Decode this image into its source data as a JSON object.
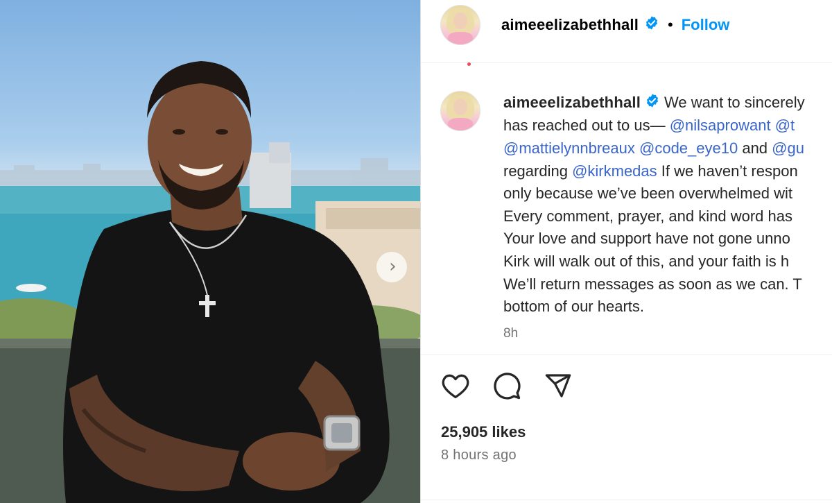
{
  "post": {
    "username": "aimeeelizabethhall",
    "follow_label": "Follow",
    "separator_dot": "•",
    "verified_icon": "verified-badge-icon",
    "caption_lines": [
      [
        {
          "t": "We want to sincerely"
        }
      ],
      [
        {
          "t": "has reached out to us— "
        },
        {
          "t": "@nilsaprowant",
          "m": true
        },
        {
          "t": " "
        },
        {
          "t": "@t",
          "m": true
        }
      ],
      [
        {
          "t": "@mattielynnbreaux",
          "m": true
        },
        {
          "t": " "
        },
        {
          "t": "@code_eye10",
          "m": true
        },
        {
          "t": " and "
        },
        {
          "t": "@gu",
          "m": true
        }
      ],
      [
        {
          "t": "regarding "
        },
        {
          "t": "@kirkmedas",
          "m": true
        },
        {
          "t": " If we haven’t respon"
        }
      ],
      [
        {
          "t": "only because we’ve been overwhelmed wit"
        }
      ],
      [
        {
          "t": "Every comment, prayer, and kind word has"
        }
      ],
      [
        {
          "t": "Your love and support have not gone unno"
        }
      ],
      [
        {
          "t": "Kirk will walk out of this, and your faith is h"
        }
      ],
      [
        {
          "t": "We’ll return messages as soon as we can. T"
        }
      ],
      [
        {
          "t": "bottom of our hearts."
        }
      ]
    ],
    "caption_age": "8h",
    "likes_text": "25,905 likes",
    "time_ago": "8 hours ago",
    "actions": {
      "like_icon": "heart-icon",
      "comment_icon": "comment-icon",
      "share_icon": "share-icon"
    },
    "carousel_next_icon": "chevron-right-icon",
    "carousel_next_glyph": "›"
  },
  "colors": {
    "follow": "#0095f6",
    "mention": "#3a65c9",
    "secondary_text": "#737373",
    "verified": "#0095f6"
  }
}
